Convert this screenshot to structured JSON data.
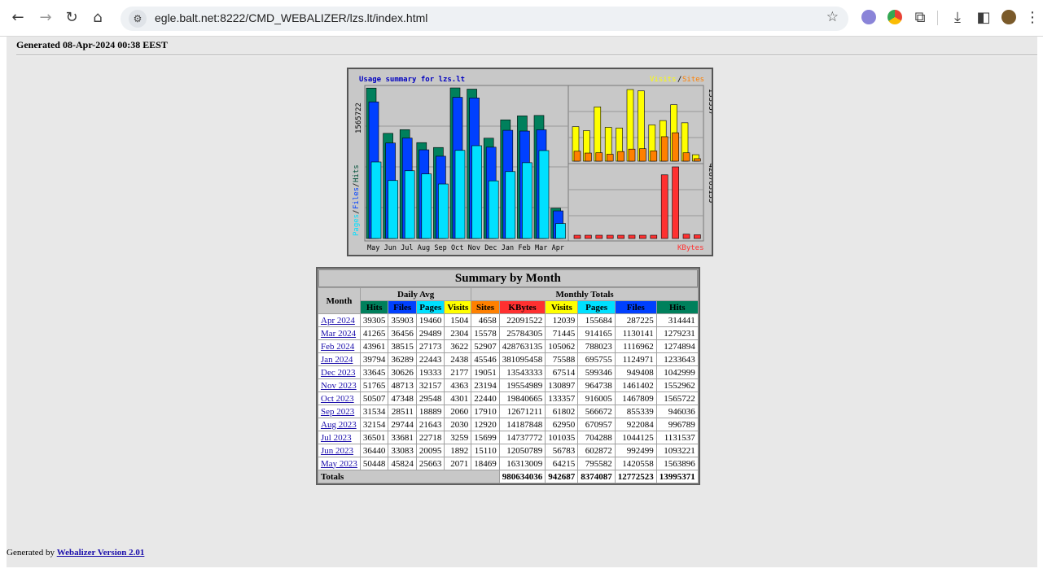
{
  "browser": {
    "url": "egle.balt.net:8222/CMD_WEBALIZER/lzs.lt/index.html"
  },
  "page": {
    "generated": "Generated 08-Apr-2024 00:38 EEST"
  },
  "graph": {
    "title": "Usage summary for lzs.lt",
    "left_axis_max": "1565722",
    "left_axis_label_pages": "Pages",
    "left_axis_label_files": "Files",
    "left_axis_label_hits": "Hits",
    "right_top_max": "133357",
    "right_bottom_max": "428763135",
    "legend_visits": "Visits",
    "legend_sites": "Sites",
    "legend_kbytes": "KBytes",
    "months": [
      "May",
      "Jun",
      "Jul",
      "Aug",
      "Sep",
      "Oct",
      "Nov",
      "Dec",
      "Jan",
      "Feb",
      "Mar",
      "Apr"
    ],
    "colors": {
      "hits": "#00805c",
      "files": "#0040ff",
      "pages": "#00e0ff",
      "visits": "#ffff00",
      "sites": "#ff8000",
      "kbytes": "#ff3030"
    }
  },
  "chart_data": {
    "type": "bar",
    "title": "Usage summary for lzs.lt",
    "categories": [
      "May",
      "Jun",
      "Jul",
      "Aug",
      "Sep",
      "Oct",
      "Nov",
      "Dec",
      "Jan",
      "Feb",
      "Mar",
      "Apr"
    ],
    "series": [
      {
        "name": "Hits",
        "values": [
          1563896,
          1093221,
          1131537,
          996789,
          946036,
          1565722,
          1552962,
          1042999,
          1233643,
          1274894,
          1279231,
          314441
        ]
      },
      {
        "name": "Files",
        "values": [
          1420558,
          992499,
          1044125,
          922084,
          855339,
          1467809,
          1461402,
          949408,
          1124971,
          1116962,
          1130141,
          287225
        ]
      },
      {
        "name": "Pages",
        "values": [
          795582,
          602872,
          704288,
          670957,
          566672,
          916005,
          964738,
          599346,
          695755,
          788023,
          914165,
          155684
        ]
      },
      {
        "name": "Visits",
        "values": [
          64215,
          56783,
          101035,
          62950,
          61802,
          133357,
          130897,
          67514,
          75588,
          105062,
          71445,
          12039
        ]
      },
      {
        "name": "Sites",
        "values": [
          18469,
          15110,
          15699,
          12920,
          17910,
          22440,
          23194,
          19051,
          45546,
          52907,
          15578,
          4658
        ]
      },
      {
        "name": "KBytes",
        "values": [
          16313009,
          12050789,
          14737772,
          14187848,
          12671211,
          19840665,
          19554989,
          13543333,
          381095458,
          428763135,
          25784305,
          22091522
        ]
      }
    ]
  },
  "table": {
    "title": "Summary by Month",
    "h_month": "Month",
    "h_daily": "Daily Avg",
    "h_monthly": "Monthly Totals",
    "cols_daily": [
      "Hits",
      "Files",
      "Pages",
      "Visits"
    ],
    "cols_monthly": [
      "Sites",
      "KBytes",
      "Visits",
      "Pages",
      "Files",
      "Hits"
    ],
    "rows": [
      {
        "month": "Apr 2024",
        "d": [
          "39305",
          "35903",
          "19460",
          "1504"
        ],
        "m": [
          "4658",
          "22091522",
          "12039",
          "155684",
          "287225",
          "314441"
        ]
      },
      {
        "month": "Mar 2024",
        "d": [
          "41265",
          "36456",
          "29489",
          "2304"
        ],
        "m": [
          "15578",
          "25784305",
          "71445",
          "914165",
          "1130141",
          "1279231"
        ]
      },
      {
        "month": "Feb 2024",
        "d": [
          "43961",
          "38515",
          "27173",
          "3622"
        ],
        "m": [
          "52907",
          "428763135",
          "105062",
          "788023",
          "1116962",
          "1274894"
        ]
      },
      {
        "month": "Jan 2024",
        "d": [
          "39794",
          "36289",
          "22443",
          "2438"
        ],
        "m": [
          "45546",
          "381095458",
          "75588",
          "695755",
          "1124971",
          "1233643"
        ]
      },
      {
        "month": "Dec 2023",
        "d": [
          "33645",
          "30626",
          "19333",
          "2177"
        ],
        "m": [
          "19051",
          "13543333",
          "67514",
          "599346",
          "949408",
          "1042999"
        ]
      },
      {
        "month": "Nov 2023",
        "d": [
          "51765",
          "48713",
          "32157",
          "4363"
        ],
        "m": [
          "23194",
          "19554989",
          "130897",
          "964738",
          "1461402",
          "1552962"
        ]
      },
      {
        "month": "Oct 2023",
        "d": [
          "50507",
          "47348",
          "29548",
          "4301"
        ],
        "m": [
          "22440",
          "19840665",
          "133357",
          "916005",
          "1467809",
          "1565722"
        ]
      },
      {
        "month": "Sep 2023",
        "d": [
          "31534",
          "28511",
          "18889",
          "2060"
        ],
        "m": [
          "17910",
          "12671211",
          "61802",
          "566672",
          "855339",
          "946036"
        ]
      },
      {
        "month": "Aug 2023",
        "d": [
          "32154",
          "29744",
          "21643",
          "2030"
        ],
        "m": [
          "12920",
          "14187848",
          "62950",
          "670957",
          "922084",
          "996789"
        ]
      },
      {
        "month": "Jul 2023",
        "d": [
          "36501",
          "33681",
          "22718",
          "3259"
        ],
        "m": [
          "15699",
          "14737772",
          "101035",
          "704288",
          "1044125",
          "1131537"
        ]
      },
      {
        "month": "Jun 2023",
        "d": [
          "36440",
          "33083",
          "20095",
          "1892"
        ],
        "m": [
          "15110",
          "12050789",
          "56783",
          "602872",
          "992499",
          "1093221"
        ]
      },
      {
        "month": "May 2023",
        "d": [
          "50448",
          "45824",
          "25663",
          "2071"
        ],
        "m": [
          "18469",
          "16313009",
          "64215",
          "795582",
          "1420558",
          "1563896"
        ]
      }
    ],
    "totals_label": "Totals",
    "totals": [
      "980634036",
      "942687",
      "8374087",
      "12772523",
      "13995371"
    ]
  },
  "footer": {
    "prefix": "Generated by",
    "link": "Webalizer Version 2.01"
  }
}
